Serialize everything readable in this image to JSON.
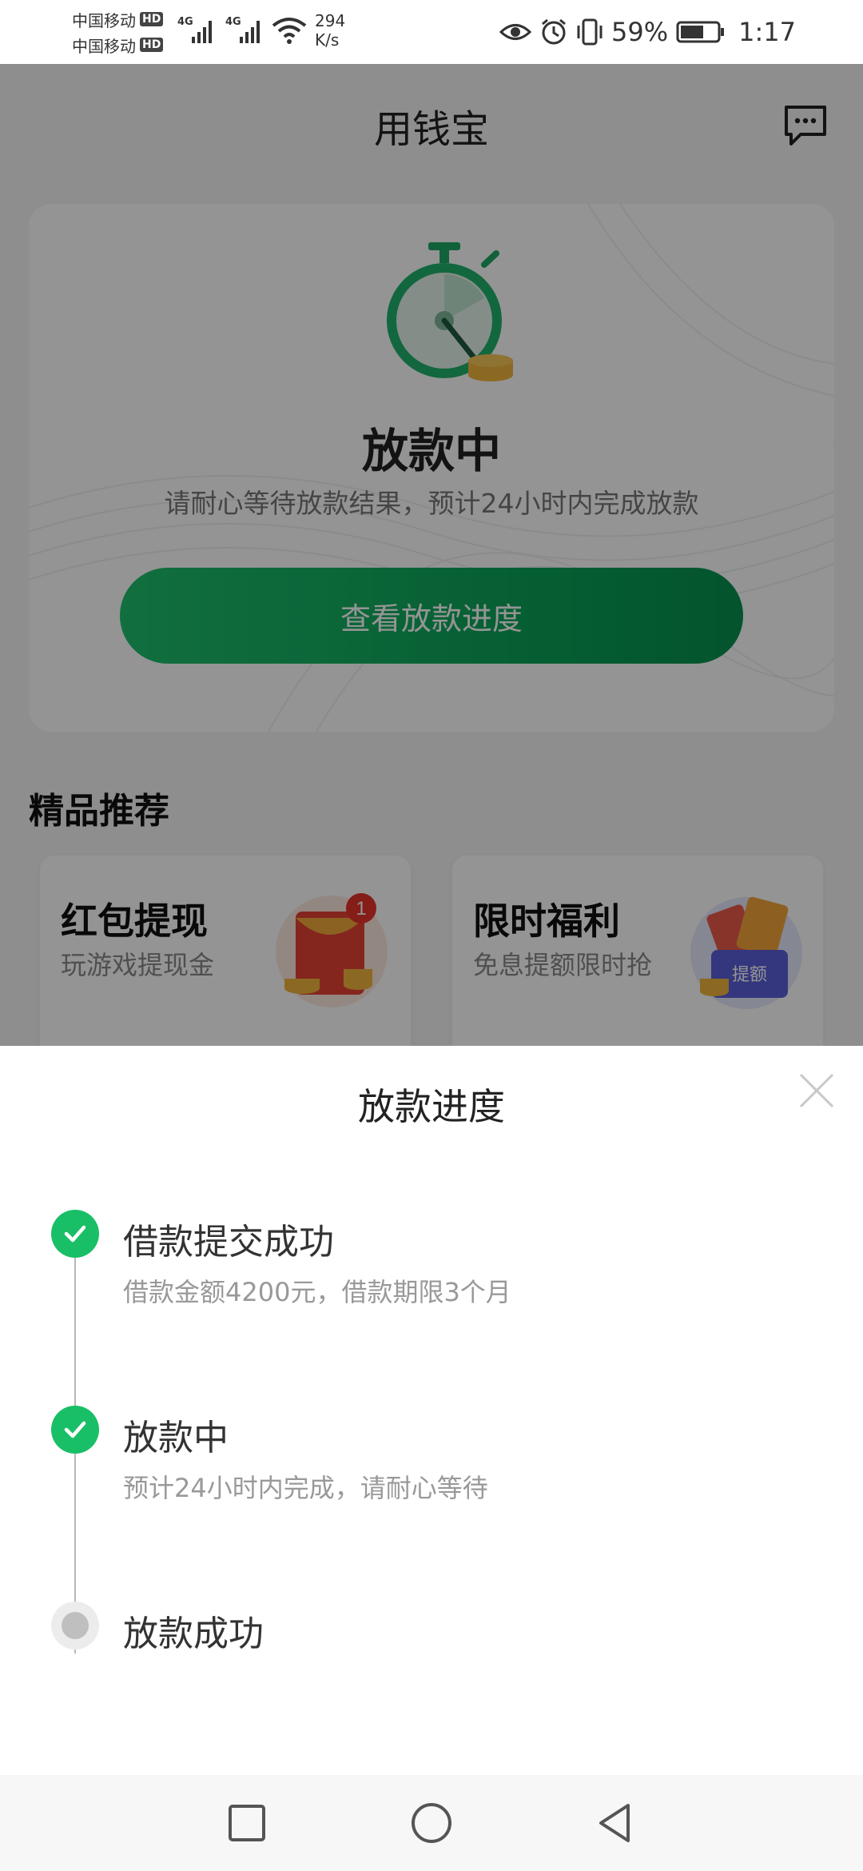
{
  "status_bar": {
    "carrier_1": "中国移动",
    "carrier_2": "中国移动",
    "hd_badge": "HD",
    "network_tag": "4G",
    "speed_value": "294",
    "speed_unit": "K/s",
    "battery_percent": "59%",
    "time": "1:17",
    "icons": [
      "eye-icon",
      "alarm-icon",
      "vibrate-icon",
      "battery-icon",
      "wifi-icon",
      "signal-icon"
    ]
  },
  "header": {
    "title": "用钱宝",
    "chat_icon": "chat-bubble-icon"
  },
  "status_card": {
    "illustration": "stopwatch-icon",
    "title": "放款中",
    "description": "请耐心等待放款结果，预计24小时内完成放款",
    "button_label": "查看放款进度"
  },
  "recommend": {
    "title": "精品推荐",
    "cards": [
      {
        "title": "红包提现",
        "subtitle": "玩游戏提现金",
        "badge": "1",
        "illustration": "red-envelope-icon"
      },
      {
        "title": "限时福利",
        "subtitle": "免息提额限时抢",
        "badge_label": "提额",
        "illustration": "coupon-gift-icon"
      }
    ]
  },
  "sheet": {
    "title": "放款进度",
    "close_icon": "close-icon",
    "steps": [
      {
        "title": "借款提交成功",
        "description": "借款金额4200元，借款期限3个月",
        "state": "done"
      },
      {
        "title": "放款中",
        "description": "预计24小时内完成，请耐心等待",
        "state": "done"
      },
      {
        "title": "放款成功",
        "description": "",
        "state": "pending"
      }
    ]
  },
  "nav_bar": {
    "icons": [
      "recent-apps-icon",
      "home-icon",
      "back-icon"
    ]
  },
  "colors": {
    "accent_green": "#19bf67",
    "button_green": "#09a157",
    "overlay": "rgba(0,0,0,0.42)"
  }
}
